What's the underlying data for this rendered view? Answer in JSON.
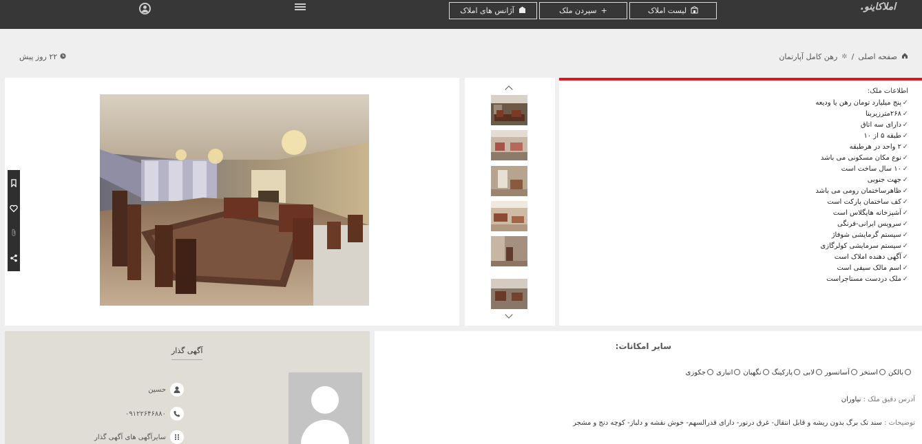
{
  "header": {
    "brand": "املاکاینو.",
    "nav": [
      {
        "label": "لیست املاک",
        "icon": "building-icon"
      },
      {
        "label": "سپردن ملک",
        "icon": "plus-icon"
      },
      {
        "label": "آژانس های املاک",
        "icon": "agency-icon"
      }
    ],
    "menu_icon": "hamburger-icon",
    "user_icon": "user-circle-icon"
  },
  "breadcrumb": {
    "home": "صفحه اصلی",
    "separator": "/",
    "current": "رهن کامل آپارتمان"
  },
  "posted": "۲۲ روز پیش",
  "info": {
    "title": "اطلاعات ملک:",
    "features": [
      "پنج میلیارد تومان رهن یا ودیعه",
      "۲۶۸مترزیربنا",
      "دارای سه اتاق",
      "طبقه ۵ از ۱۰",
      "۲ واحد در هرطبقه",
      "نوع مکان مسکونی می باشد",
      "۱۰ سال ساخت است",
      "جهت جنوبی",
      "ظاهرساختمان رومی می باشد",
      "کف ساختمان پارکت است",
      "آشپزخانه هایگلاس است",
      "سرویس ایرانی-فرنگی",
      "سیستم گرمایشی شوفاژ",
      "سیستم سرمایشی کولرگازی",
      "آگهی دهنده املاک است",
      "اسم مالک سیفی است",
      "ملک دردست مستاجراست"
    ]
  },
  "amenities": {
    "title": "سایر امکانات:",
    "items": [
      "بالکن",
      "استخر",
      "آسانسور",
      "لابی",
      "پارکینگ",
      "نگهبان",
      "انباری",
      "جکوزی"
    ]
  },
  "address": {
    "label": "آدرس دقیق ملک :",
    "value": "نیاوران"
  },
  "description": {
    "label": "توضیحات :",
    "value": "سند تک برگ بدون ریشه و قابل انتقال- غرق درنور- دارای قدرالسهم- خوش نقشه و دلباز- کوچه دنج و مشجر"
  },
  "owner": {
    "title": "آگهی گذار",
    "name": "حسین",
    "phone": "۰۹۱۲۲۶۴۶۸۸۰",
    "other_ads": "سایرآگهی های آگهی گذار"
  },
  "colors": {
    "accent": "#d71920",
    "topbar": "#373737"
  }
}
